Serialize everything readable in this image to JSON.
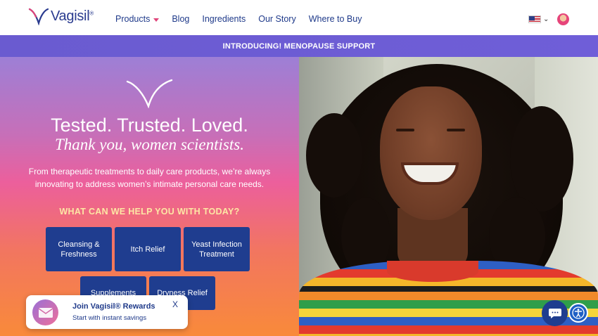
{
  "header": {
    "logo_text": "Vagisil",
    "logo_mark": "®",
    "nav": [
      {
        "label": "Products",
        "has_dropdown": true
      },
      {
        "label": "Blog"
      },
      {
        "label": "Ingredients"
      },
      {
        "label": "Our Story"
      },
      {
        "label": "Where to Buy"
      }
    ],
    "locale_icon": "us-flag-icon",
    "account_icon": "avatar-icon"
  },
  "announcement": {
    "text": "INTRODUCING! MENOPAUSE SUPPORT"
  },
  "hero": {
    "title": "Tested. Trusted. Loved.",
    "subtitle": "Thank you, women scientists.",
    "description": "From therapeutic treatments to daily care products, we’re always innovating to address women’s intimate personal care needs.",
    "help_heading": "WHAT CAN WE HELP YOU WITH TODAY?",
    "categories": [
      {
        "label": "Cleansing & Freshness"
      },
      {
        "label": "Itch Relief"
      },
      {
        "label": "Yeast Infection Treatment"
      },
      {
        "label": "Supplements"
      },
      {
        "label": "Dryness Relief"
      }
    ]
  },
  "rewards": {
    "title": "Join Vagisil® Rewards",
    "subtitle": "Start with instant savings",
    "close": "X"
  },
  "colors": {
    "brand_navy": "#1f3d8f",
    "accent_pink": "#e0447a",
    "announce_purple": "#6a5bd0",
    "help_heading": "#fde7a4"
  },
  "icons": {
    "chat": "chat-bubble-icon",
    "accessibility": "accessibility-icon",
    "rewards": "envelope-icon"
  }
}
